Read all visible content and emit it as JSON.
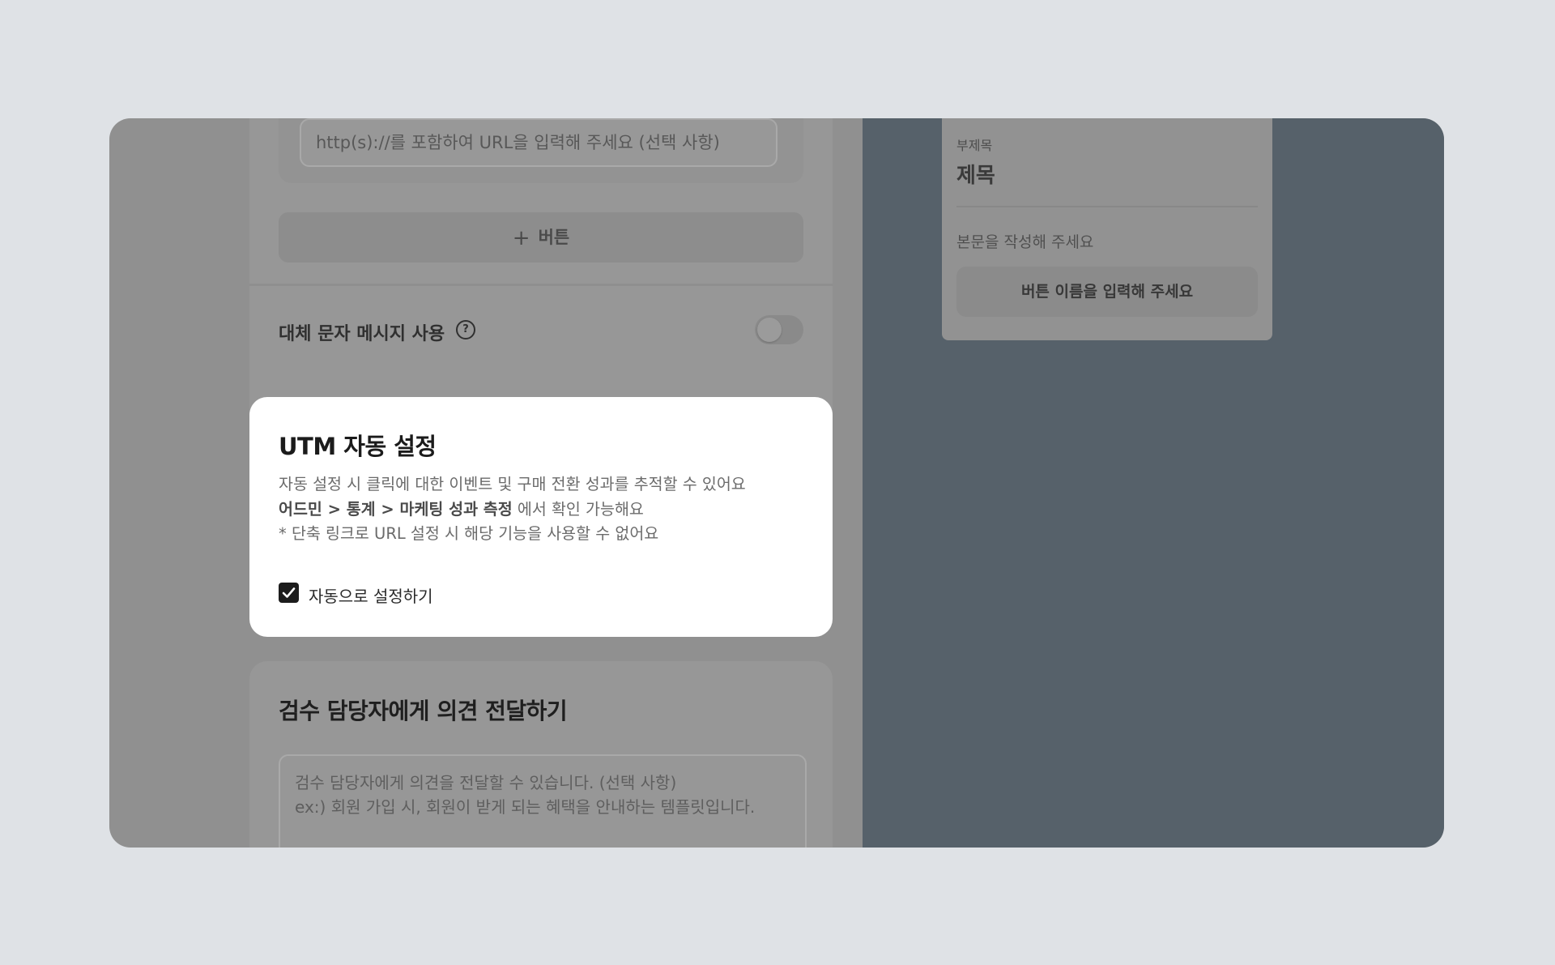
{
  "link_section": {
    "url_placeholder": "http(s)://를 포함하여 URL을 입력해 주세요 (선택 사항)",
    "add_button_label": "버튼"
  },
  "fallback": {
    "label": "대체 문자 메시지 사용",
    "help_glyph": "?",
    "toggle_on": false
  },
  "utm": {
    "title": "UTM 자동 설정",
    "desc_line1": "자동 설정 시 클릭에 대한 이벤트 및 구매 전환 성과를 추적할 수 있어요",
    "desc_line2_bold": "어드민 > 통계 > 마케팅 성과 측정",
    "desc_line2_rest": " 에서 확인 가능해요",
    "desc_line3": "* 단축 링크로 URL 설정 시 해당 기능을 사용할 수 없어요",
    "checkbox_label": "자동으로 설정하기",
    "checkbox_checked": true
  },
  "review": {
    "title": "검수 담당자에게 의견 전달하기",
    "placeholder_line1": "검수 담당자에게 의견을 전달할 수 있습니다. (선택 사항)",
    "placeholder_line2": "ex:) 회원 가입 시, 회원이 받게 되는 혜택을 안내하는 템플릿입니다."
  },
  "preview": {
    "subtitle": "부제목",
    "title": "제목",
    "body": "본문을 작성해 주세요",
    "button_label": "버튼 이름을 입력해 주세요"
  }
}
